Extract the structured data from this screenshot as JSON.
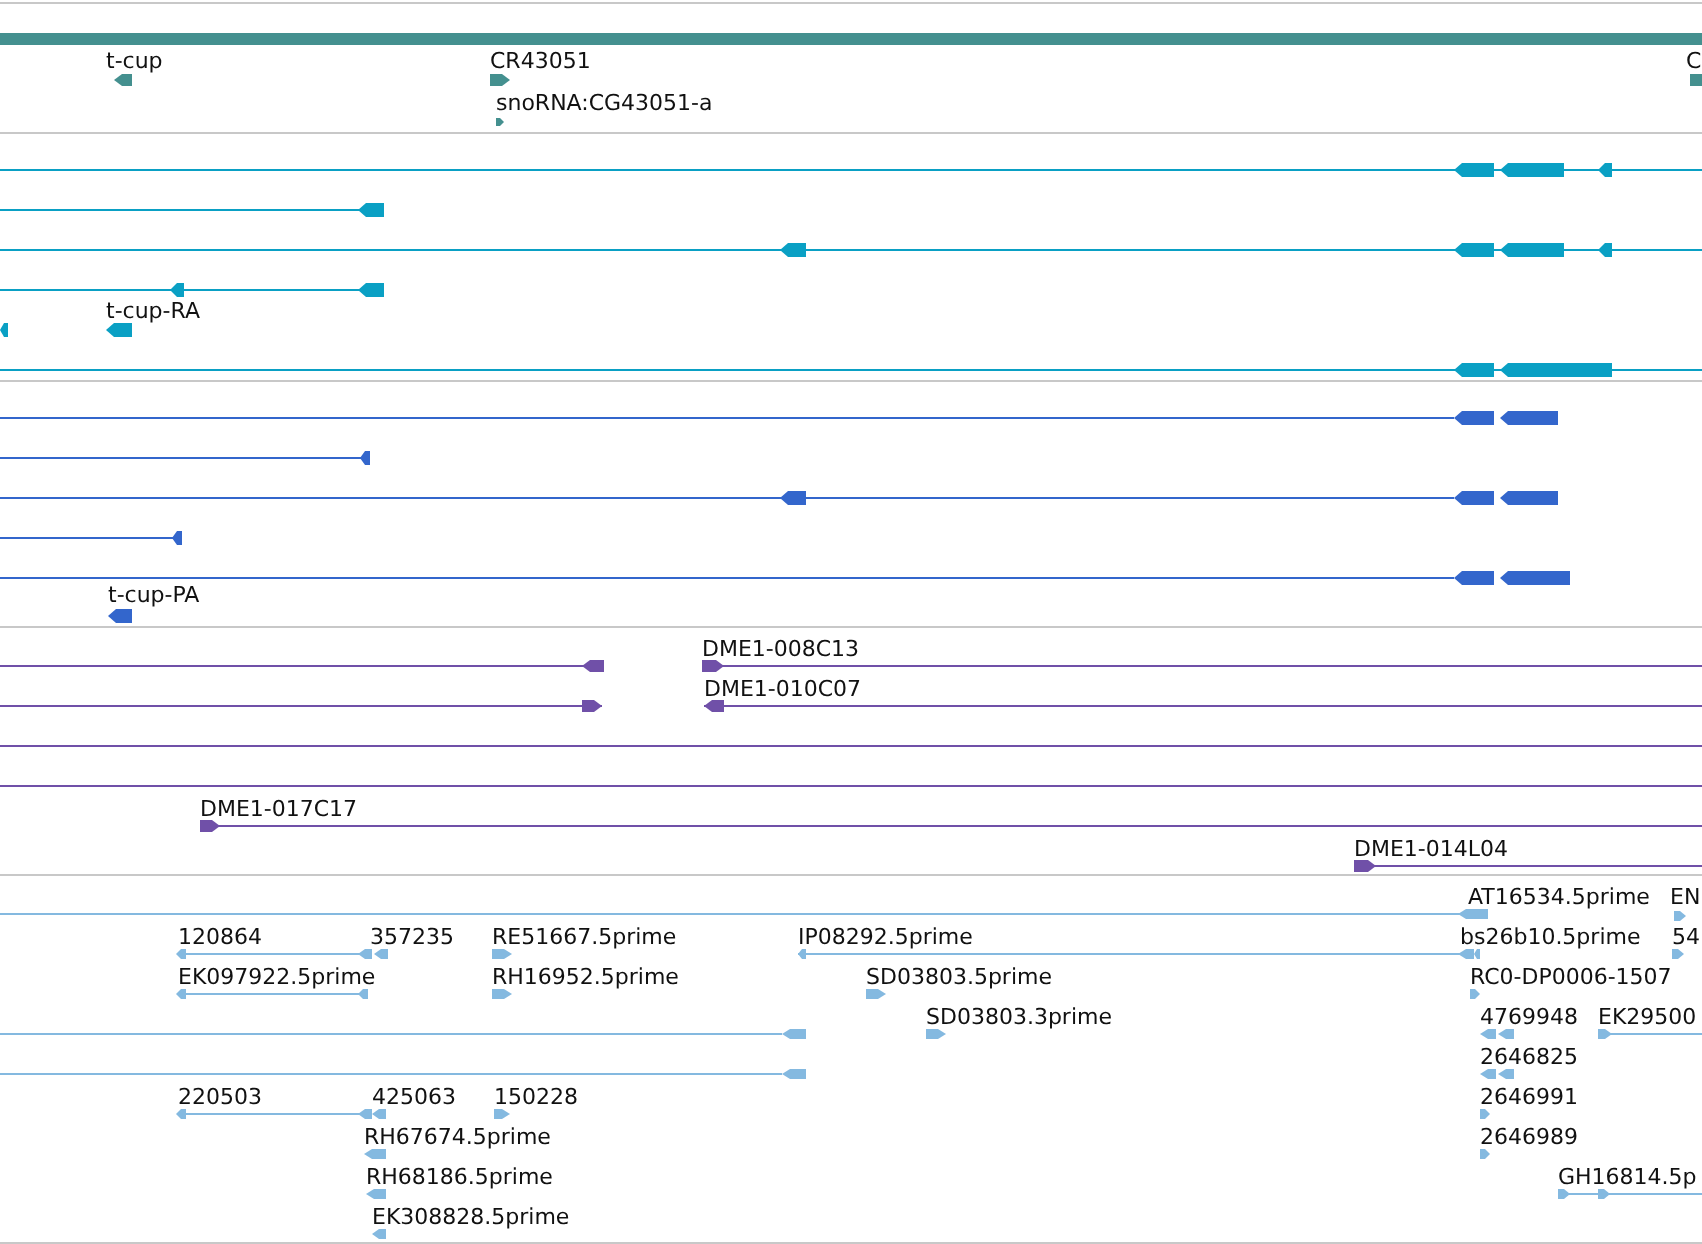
{
  "tracks": [
    {
      "kind": "gene",
      "color": "#44908f",
      "features": [
        {
          "kind": "plain"
        },
        {
          "label": "t-cup",
          "kind": "reverse"
        },
        {
          "label": "CR43051",
          "kind": "forward"
        },
        {
          "label": "snoRNA:CG43051-a",
          "kind": "forward"
        },
        {
          "label": "C",
          "kind": "plain"
        }
      ]
    },
    {
      "kind": "transcript",
      "color": "#0aa0c4",
      "features": [
        {
          "kind": "reverse"
        },
        {
          "kind": "reverse"
        },
        {
          "kind": "reverse"
        },
        {
          "kind": "reverse"
        },
        {
          "label": "t-cup-RA",
          "kind": "reverse"
        },
        {
          "kind": "reverse"
        },
        {
          "kind": "reverse"
        }
      ]
    },
    {
      "kind": "protein",
      "color": "#3366cc",
      "features": [
        {
          "kind": "reverse"
        },
        {
          "kind": "reverse"
        },
        {
          "kind": "reverse"
        },
        {
          "kind": "reverse"
        },
        {
          "kind": "reverse"
        },
        {
          "label": "t-cup-PA",
          "kind": "reverse"
        }
      ]
    },
    {
      "kind": "clone",
      "color": "#7050a8",
      "features": [
        {
          "kind": "reverse"
        },
        {
          "label": "DME1-008C13",
          "kind": "forward"
        },
        {
          "kind": "forward"
        },
        {
          "label": "DME1-010C07",
          "kind": "reverse"
        },
        {
          "kind": "plain"
        },
        {
          "kind": "plain"
        },
        {
          "label": "DME1-017C17",
          "kind": "forward"
        },
        {
          "label": "DME1-014L04",
          "kind": "forward"
        }
      ]
    },
    {
      "kind": "est",
      "color": "#84b9e0",
      "features": [
        {
          "label": "AT16534.5prime",
          "kind": "reverse"
        },
        {
          "label": "EN",
          "kind": "forward"
        },
        {
          "label": "120864",
          "kind": "reverse"
        },
        {
          "label": "357235",
          "kind": "reverse"
        },
        {
          "label": "RE51667.5prime",
          "kind": "forward"
        },
        {
          "label": "IP08292.5prime",
          "kind": "reverse"
        },
        {
          "label": "bs26b10.5prime",
          "kind": "reverse"
        },
        {
          "label": "54",
          "kind": "forward"
        },
        {
          "label": "EK097922.5prime",
          "kind": "reverse"
        },
        {
          "label": "RH16952.5prime",
          "kind": "forward"
        },
        {
          "label": "SD03803.5prime",
          "kind": "forward"
        },
        {
          "label": "RC0-DP0006-1507",
          "kind": "forward"
        },
        {
          "kind": "reverse"
        },
        {
          "label": "SD03803.3prime",
          "kind": "forward"
        },
        {
          "label": "4769948",
          "kind": "reverse"
        },
        {
          "label": "EK29500",
          "kind": "forward"
        },
        {
          "kind": "reverse"
        },
        {
          "label": "2646825",
          "kind": "reverse"
        },
        {
          "label": "220503",
          "kind": "reverse"
        },
        {
          "label": "425063",
          "kind": "reverse"
        },
        {
          "label": "150228",
          "kind": "forward"
        },
        {
          "label": "2646991",
          "kind": "forward"
        },
        {
          "label": "RH67674.5prime",
          "kind": "reverse"
        },
        {
          "label": "2646989",
          "kind": "forward"
        },
        {
          "label": "RH68186.5prime",
          "kind": "reverse"
        },
        {
          "label": "GH16814.5p",
          "kind": "forward"
        },
        {
          "label": "EK308828.5prime",
          "kind": "reverse"
        }
      ]
    }
  ]
}
